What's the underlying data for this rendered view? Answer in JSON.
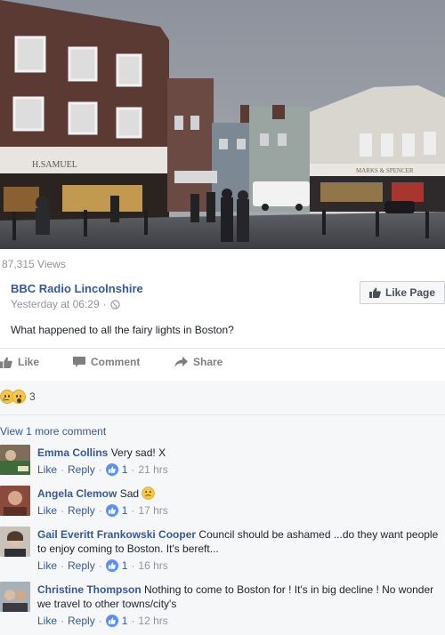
{
  "post": {
    "views": "87,315 Views",
    "page_name": "BBC Radio Lincolnshire",
    "timestamp": "Yesterday at 06:29",
    "separator": "·",
    "like_page_label": "Like Page",
    "text": "What happened to all the fairy lights in Boston?",
    "photo_signs": [
      "H.SAMUEL",
      "MARKS & SPENCER"
    ]
  },
  "actions": {
    "like": "Like",
    "comment": "Comment",
    "share": "Share"
  },
  "reactions": {
    "types": [
      "sad",
      "wow"
    ],
    "count": "3"
  },
  "comments_section": {
    "view_more": "View 1 more comment",
    "like_label": "Like",
    "reply_label": "Reply",
    "comments": [
      {
        "name": "Emma Collins",
        "text": "Very sad! X",
        "likes": "1",
        "time": "21 hrs"
      },
      {
        "name": "Angela Clemow",
        "text": "Sad",
        "likes": "1",
        "time": "17 hrs",
        "emoji": "sad-face"
      },
      {
        "name": "Gail Everitt Frankowski Cooper",
        "text": "Council should be ashamed ...do they want people to enjoy coming to Boston. It's bereft...",
        "likes": "1",
        "time": "16 hrs"
      },
      {
        "name": "Christine Thompson",
        "text": "Nothing to come to Boston for ! It's in big decline ! No wonder we travel to other towns/city's",
        "likes": "1",
        "time": "12 hrs"
      }
    ]
  },
  "colors": {
    "link_blue": "#365899",
    "meta_grey": "#90949c",
    "like_blue": "#5890ff"
  }
}
